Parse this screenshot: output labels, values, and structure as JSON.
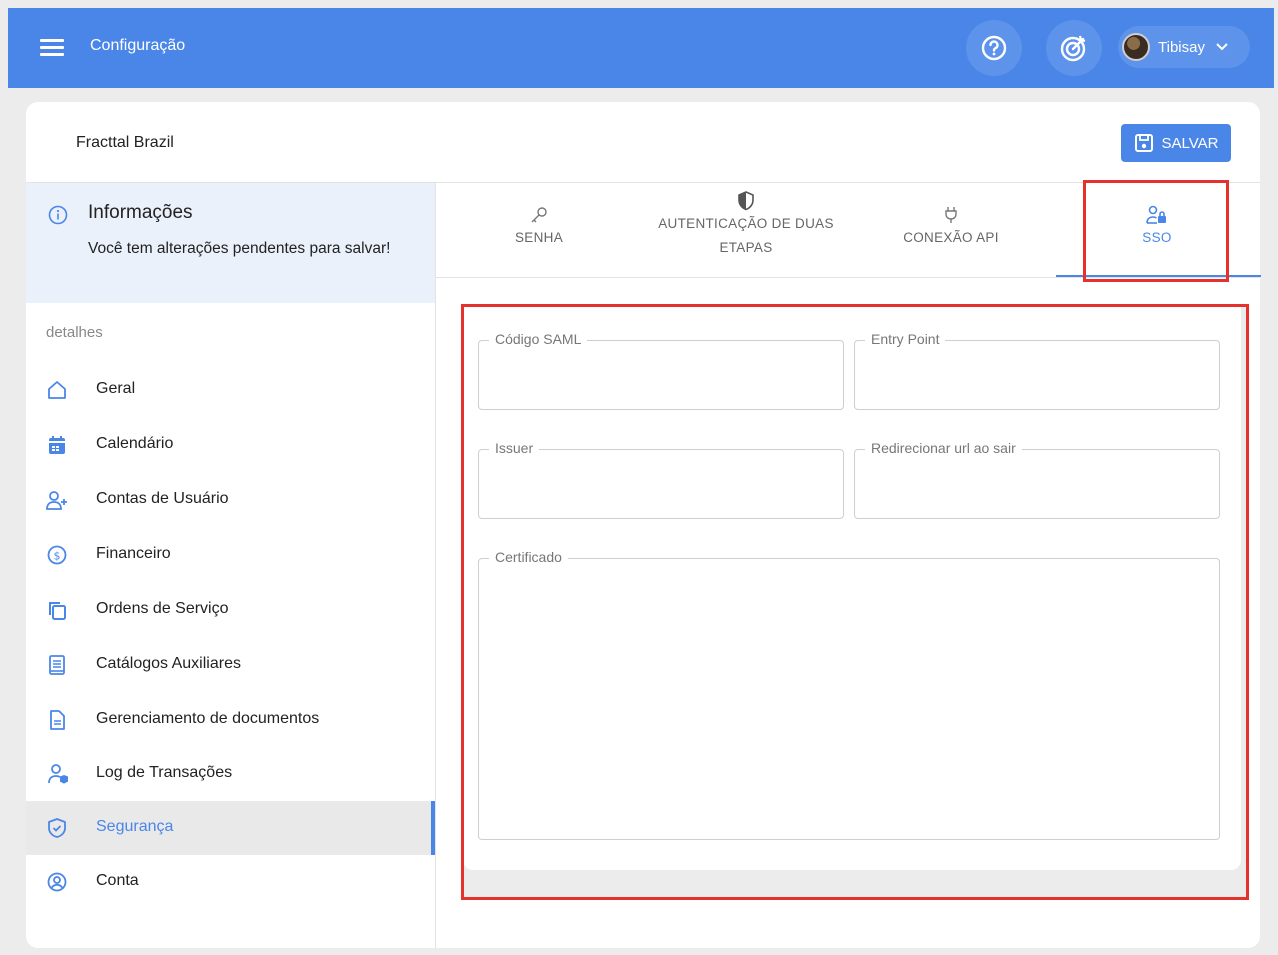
{
  "topbar": {
    "menu_icon": "hamburger-icon",
    "title": "Configuração",
    "help_icon": "help-circle-icon",
    "target_icon": "target-icon",
    "user_name": "Tibisay",
    "user_chevron": "chevron-down-icon"
  },
  "card": {
    "company": "Fracttal Brazil",
    "save_label": "SALVAR"
  },
  "info": {
    "title": "Informações",
    "text": "Você tem alterações pendentes para salvar!"
  },
  "sidebar": {
    "heading": "detalhes",
    "items": [
      {
        "label": "Geral",
        "icon": "home-icon"
      },
      {
        "label": "Calendário",
        "icon": "calendar-icon"
      },
      {
        "label": "Contas de Usuário",
        "icon": "user-add-icon"
      },
      {
        "label": "Financeiro",
        "icon": "dollar-icon"
      },
      {
        "label": "Ordens de Serviço",
        "icon": "copy-icon"
      },
      {
        "label": "Catálogos Auxiliares",
        "icon": "catalog-icon"
      },
      {
        "label": "Gerenciamento de documentos",
        "icon": "document-icon"
      },
      {
        "label": "Log de Transações",
        "icon": "user-shield-icon"
      },
      {
        "label": "Segurança",
        "icon": "shield-check-icon",
        "active": true
      },
      {
        "label": "Conta",
        "icon": "account-circle-icon"
      }
    ]
  },
  "tabs": [
    {
      "label": "SENHA",
      "icon": "key-icon"
    },
    {
      "label": "AUTENTICAÇÃO DE DUAS ETAPAS",
      "line1": "AUTENTICAÇÃO DE DUAS",
      "line2": "ETAPAS",
      "icon": "shield-half-icon"
    },
    {
      "label": "CONEXÃO API",
      "icon": "plug-icon"
    },
    {
      "label": "SSO",
      "icon": "user-lock-icon",
      "active": true
    }
  ],
  "form": {
    "codigo_saml": {
      "label": "Código SAML",
      "value": ""
    },
    "entry_point": {
      "label": "Entry Point",
      "value": ""
    },
    "issuer": {
      "label": "Issuer",
      "value": ""
    },
    "redirect_url": {
      "label": "Redirecionar url ao sair",
      "value": ""
    },
    "certificado": {
      "label": "Certificado",
      "value": ""
    }
  },
  "colors": {
    "primary": "#4a86e8",
    "highlight": "#e5322c"
  }
}
